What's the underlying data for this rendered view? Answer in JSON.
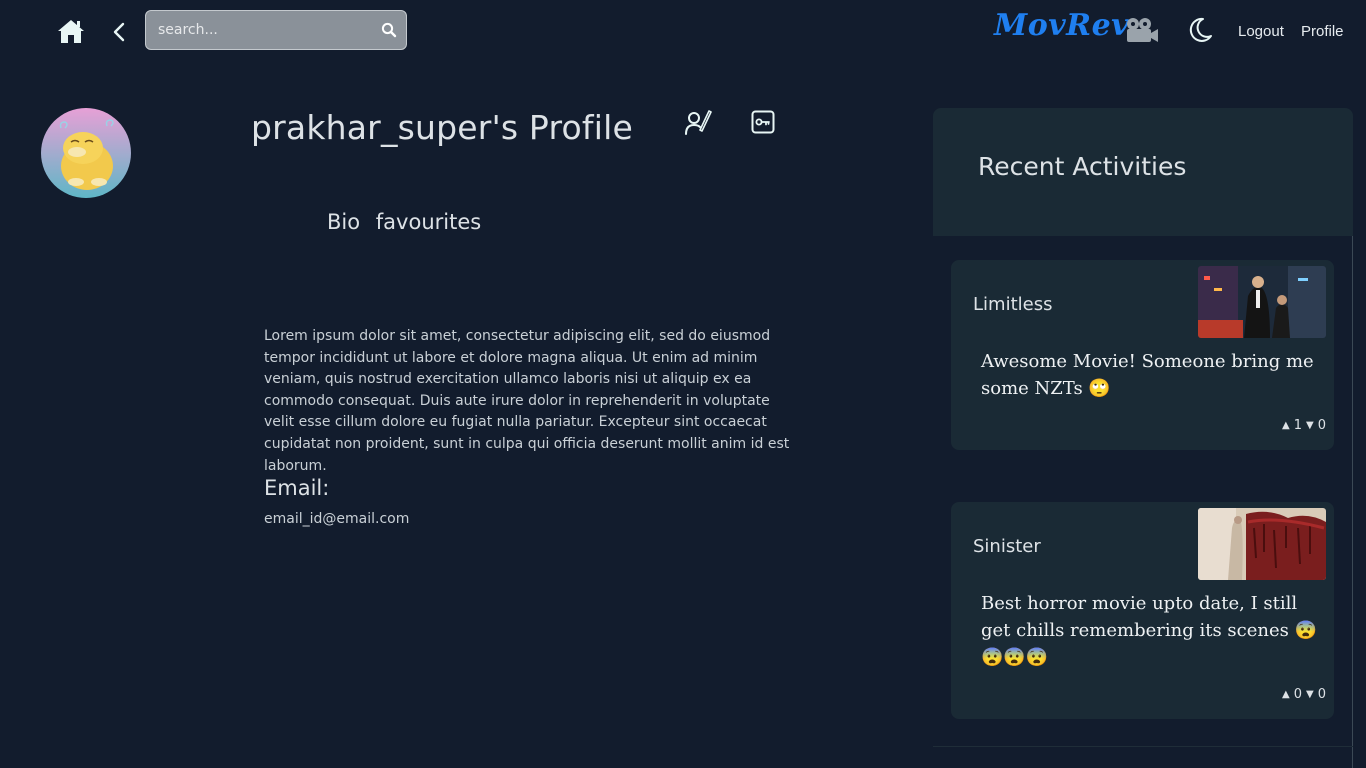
{
  "header": {
    "search_placeholder": "search...",
    "logo": "MovRev",
    "logout": "Logout",
    "profile": "Profile"
  },
  "profile": {
    "title": "prakhar_super's Profile",
    "tabs": [
      "Bio",
      "favourites"
    ],
    "bio": "Lorem ipsum dolor sit amet, consectetur adipiscing elit, sed do eiusmod tempor incididunt ut labore et dolore magna aliqua. Ut enim ad minim veniam, quis nostrud exercitation ullamco laboris nisi ut aliquip ex ea commodo consequat. Duis aute irure dolor in reprehenderit in voluptate velit esse cillum dolore eu fugiat nulla pariatur. Excepteur sint occaecat cupidatat non proident, sunt in culpa qui officia deserunt mollit anim id est laborum.",
    "email_label": "Email:",
    "email_value": "email_id@email.com"
  },
  "activities": {
    "title": "Recent Activities",
    "items": [
      {
        "movie": "Limitless",
        "review": "Awesome Movie! Someone bring me some NZTs 🙄",
        "upvotes": "1",
        "downvotes": "0"
      },
      {
        "movie": "Sinister",
        "review": "Best horror movie upto date, I still get chills remembering its scenes 😨😨😨😨",
        "upvotes": "0",
        "downvotes": "0"
      }
    ]
  },
  "colors": {
    "background": "#121c2d",
    "panel": "#1a2a35",
    "brand": "#1f7ff0"
  },
  "icons": [
    "home-icon",
    "back-arrow-icon",
    "search-icon",
    "camera-icon",
    "moon-icon",
    "user-edit-icon",
    "key-icon",
    "upvote-icon",
    "downvote-icon"
  ]
}
